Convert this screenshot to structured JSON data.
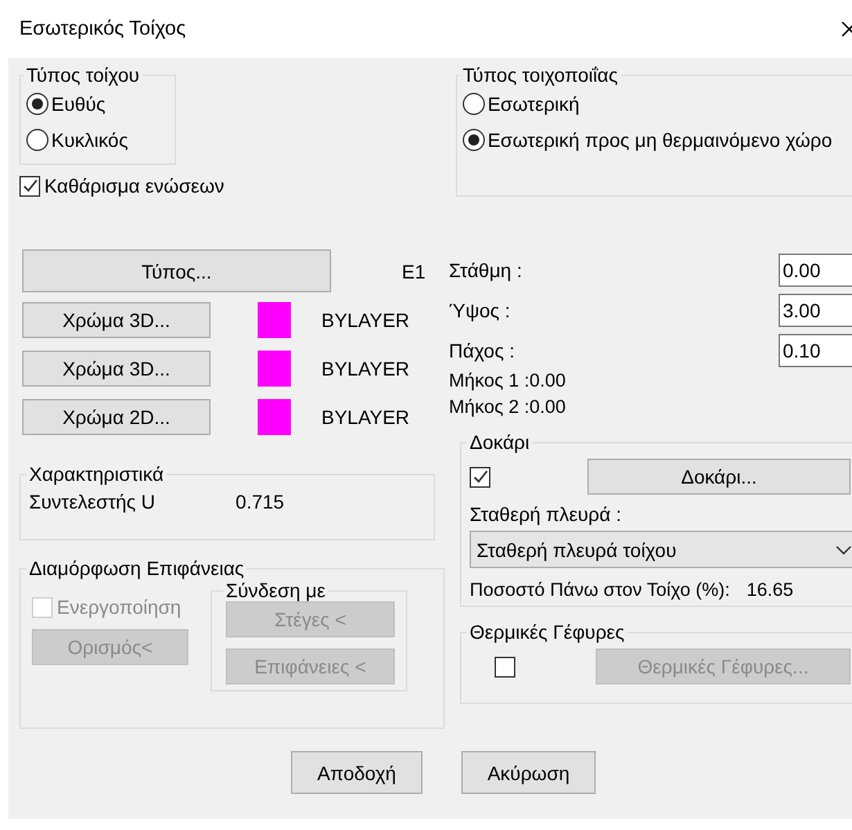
{
  "window": {
    "title": "Εσωτερικός Τοίχος"
  },
  "wall_type": {
    "title": "Τύπος τοίχου",
    "options": [
      {
        "label": "Ευθύς",
        "selected": true
      },
      {
        "label": "Κυκλικός",
        "selected": false
      }
    ]
  },
  "masonry_type": {
    "title": "Τύπος τοιχοποιΐας",
    "options": [
      {
        "label": "Εσωτερική",
        "selected": false
      },
      {
        "label": "Εσωτερική προς μη θερμαινόμενο χώρο",
        "selected": true
      }
    ]
  },
  "clean_joints": {
    "label": "Καθάρισμα ενώσεων",
    "checked": true
  },
  "type_button": {
    "label": "Τύπος...",
    "value": "E1"
  },
  "colors": [
    {
      "button": "Χρώμα 3D...",
      "color": "#ff00ff",
      "value": "BYLAYER"
    },
    {
      "button": "Χρώμα 3D...",
      "color": "#ff00ff",
      "value": "BYLAYER"
    },
    {
      "button": "Χρώμα 2D...",
      "color": "#ff00ff",
      "value": "BYLAYER"
    }
  ],
  "fields": [
    {
      "label": "Στάθμη :",
      "value": "0.00"
    },
    {
      "label": "Ύψος :",
      "value": "3.00"
    },
    {
      "label": "Πάχος :",
      "value": "0.10"
    }
  ],
  "lengths": [
    "Μήκος 1 :0.00",
    "Μήκος 2 :0.00"
  ],
  "characteristics": {
    "title": "Χαρακτηριστικά",
    "label": "Συντελεστής U",
    "value": "0.715"
  },
  "surface": {
    "title": "Διαμόρφωση Επιφάνειας",
    "enable": {
      "label": "Ενεργοποίηση",
      "checked": false,
      "disabled": true
    },
    "define_button": {
      "label": "Ορισμός<",
      "disabled": true
    },
    "link": {
      "title": "Σύνδεση με",
      "buttons": [
        {
          "label": "Στέγες <",
          "disabled": true
        },
        {
          "label": "Επιφάνειες <",
          "disabled": true
        }
      ]
    }
  },
  "beam": {
    "title": "Δοκάρι",
    "checked": true,
    "button": "Δοκάρι...",
    "fixed_side_label": "Σταθερή πλευρά :",
    "fixed_side": "Σταθερή πλευρά τοίχου",
    "percent_label": "Ποσοστό Πάνω στον Τοίχο (%):",
    "percent": "16.65"
  },
  "thermal": {
    "title": "Θερμικές Γέφυρες",
    "checked": false,
    "button": {
      "label": "Θερμικές Γέφυρες...",
      "disabled": true
    }
  },
  "buttons": [
    "Αποδοχή",
    "Ακύρωση"
  ]
}
